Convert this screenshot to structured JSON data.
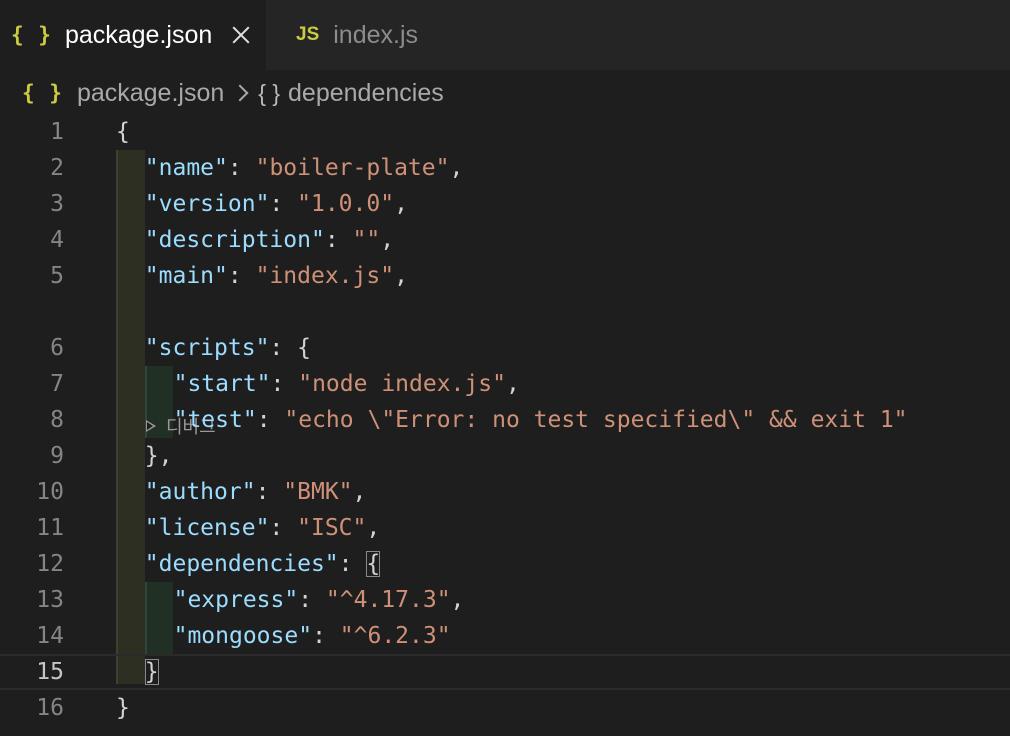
{
  "tabs": [
    {
      "icon": "{ }",
      "label": "package.json",
      "active": true
    },
    {
      "icon": "JS",
      "label": "index.js",
      "active": false
    }
  ],
  "breadcrumb": {
    "file_icon": "{ }",
    "file": "package.json",
    "symbol_icon": "{ }",
    "symbol": "dependencies"
  },
  "codelens": {
    "label": "디버그"
  },
  "current_line": 15,
  "lines": [
    {
      "n": "1",
      "tokens": [
        [
          "p",
          "{"
        ]
      ]
    },
    {
      "n": "2",
      "tokens": [
        [
          "k",
          "\"name\""
        ],
        [
          "p",
          ": "
        ],
        [
          "s",
          "\"boiler-plate\""
        ],
        [
          "p",
          ","
        ]
      ]
    },
    {
      "n": "3",
      "tokens": [
        [
          "k",
          "\"version\""
        ],
        [
          "p",
          ": "
        ],
        [
          "s",
          "\"1.0.0\""
        ],
        [
          "p",
          ","
        ]
      ]
    },
    {
      "n": "4",
      "tokens": [
        [
          "k",
          "\"description\""
        ],
        [
          "p",
          ": "
        ],
        [
          "s",
          "\"\""
        ],
        [
          "p",
          ","
        ]
      ]
    },
    {
      "n": "5",
      "tokens": [
        [
          "k",
          "\"main\""
        ],
        [
          "p",
          ": "
        ],
        [
          "s",
          "\"index.js\""
        ],
        [
          "p",
          ","
        ]
      ]
    },
    {
      "n": "6",
      "tokens": [
        [
          "k",
          "\"scripts\""
        ],
        [
          "p",
          ": {"
        ]
      ]
    },
    {
      "n": "7",
      "tokens": [
        [
          "k",
          "\"start\""
        ],
        [
          "p",
          ": "
        ],
        [
          "s",
          "\"node index.js\""
        ],
        [
          "p",
          ","
        ]
      ]
    },
    {
      "n": "8",
      "tokens": [
        [
          "k",
          "\"test\""
        ],
        [
          "p",
          ": "
        ],
        [
          "s",
          "\"echo \\\"Error: no test specified\\\" && exit 1\""
        ]
      ]
    },
    {
      "n": "9",
      "tokens": [
        [
          "p",
          "},"
        ]
      ]
    },
    {
      "n": "10",
      "tokens": [
        [
          "k",
          "\"author\""
        ],
        [
          "p",
          ": "
        ],
        [
          "s",
          "\"BMK\""
        ],
        [
          "p",
          ","
        ]
      ]
    },
    {
      "n": "11",
      "tokens": [
        [
          "k",
          "\"license\""
        ],
        [
          "p",
          ": "
        ],
        [
          "s",
          "\"ISC\""
        ],
        [
          "p",
          ","
        ]
      ]
    },
    {
      "n": "12",
      "tokens": [
        [
          "k",
          "\"dependencies\""
        ],
        [
          "p",
          ": "
        ],
        [
          "pb",
          "{"
        ]
      ]
    },
    {
      "n": "13",
      "tokens": [
        [
          "k",
          "\"express\""
        ],
        [
          "p",
          ": "
        ],
        [
          "s",
          "\"^4.17.3\""
        ],
        [
          "p",
          ","
        ]
      ]
    },
    {
      "n": "14",
      "tokens": [
        [
          "k",
          "\"mongoose\""
        ],
        [
          "p",
          ": "
        ],
        [
          "s",
          "\"^6.2.3\""
        ]
      ]
    },
    {
      "n": "15",
      "tokens": [
        [
          "pb",
          "}"
        ]
      ]
    },
    {
      "n": "16",
      "tokens": [
        [
          "p",
          "}"
        ]
      ]
    }
  ],
  "colors": {
    "key": "#9cdcfe",
    "string": "#ce9178",
    "punctuation": "#d4d4d4",
    "json_icon": "#cbcb41",
    "background": "#1e1e1e"
  }
}
